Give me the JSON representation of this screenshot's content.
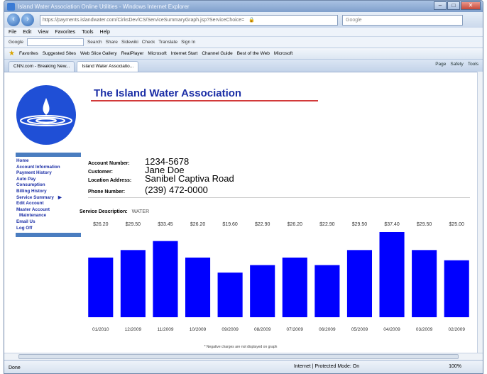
{
  "browser": {
    "window_title": "Island Water Association Online Utilities - Windows Internet Explorer",
    "address": "https://payments.islandwater.com/CirksDev/CS/ServiceSummaryGraph.jsp?ServiceChoice=",
    "search_placeholder": "Google",
    "menu": [
      "File",
      "Edit",
      "View",
      "Favorites",
      "Tools",
      "Help"
    ],
    "google_toolbar": {
      "label": "Google",
      "items": [
        "Search",
        "Share",
        "Sidewiki",
        "Check",
        "Translate",
        "Sign In"
      ]
    },
    "favorites": {
      "label": "Favorites",
      "items": [
        "Suggested Sites",
        "Web Slice Gallery",
        "RealPlayer",
        "Microsoft",
        "Internet Start",
        "Channel Guide",
        "Best of the Web",
        "Microsoft"
      ]
    },
    "tabs": [
      {
        "label": "CNN.com - Breaking New...",
        "active": false
      },
      {
        "label": "Island Water Associatio...",
        "active": true
      }
    ],
    "commands": [
      "Page",
      "Safety",
      "Tools"
    ],
    "status_left": "Done",
    "status_zone": "Internet | Protected Mode: On",
    "zoom": "100%"
  },
  "site": {
    "title": "The Island Water Association",
    "title_color": "#1b2ea6",
    "rule_color": "#d23a3a"
  },
  "sidebar": {
    "items": [
      "Home",
      "Account Information",
      "Payment History",
      "Auto Pay",
      "Consumption",
      "Billing History",
      "Service Summary",
      "Edit Account",
      "Master Account",
      "Maintenance",
      "Email Us",
      "Log Off"
    ]
  },
  "account": {
    "number_label": "Account Number:",
    "number": "1234-5678",
    "customer_label": "Customer:",
    "customer": "Jane Doe",
    "location_label": "Location Address:",
    "location": "Sanibel Captiva Road",
    "phone_label": "Phone Number:",
    "phone": "(239) 472-0000"
  },
  "service": {
    "label": "Service Description:",
    "value": "WATER"
  },
  "chart_data": {
    "type": "bar",
    "categories": [
      "01/2010",
      "12/2009",
      "11/2009",
      "10/2009",
      "09/2009",
      "08/2009",
      "07/2009",
      "06/2009",
      "05/2009",
      "04/2009",
      "03/2009",
      "02/2009"
    ],
    "value_labels": [
      "$26.20",
      "$29.50",
      "$33.45",
      "$26.20",
      "$19.60",
      "$22.90",
      "$26.20",
      "$22.90",
      "$29.50",
      "$37.40",
      "$29.50",
      "$25.00"
    ],
    "values": [
      26.2,
      29.5,
      33.45,
      26.2,
      19.6,
      22.9,
      26.2,
      22.9,
      29.5,
      37.4,
      29.5,
      25.0
    ],
    "ylim": [
      0,
      37.4
    ],
    "bar_color": "#0000ff",
    "footnote": "* Negative charges are not displayed on graph"
  }
}
